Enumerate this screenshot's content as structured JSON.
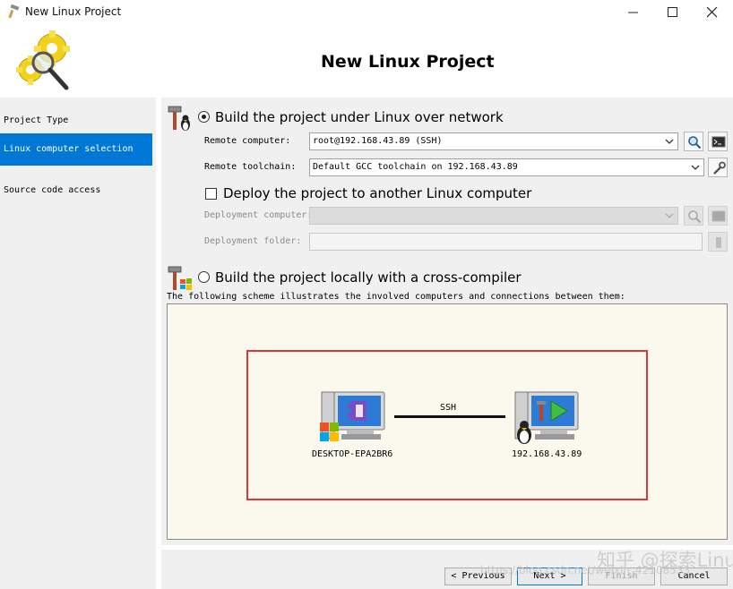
{
  "window": {
    "title": "New Linux Project"
  },
  "header": {
    "title": "New Linux Project"
  },
  "nav": {
    "items": [
      "Project Type",
      "Linux computer selection",
      "Source code access"
    ],
    "active_index": 1
  },
  "build_remote": {
    "label": "Build the project under Linux over network",
    "selected": true,
    "remote_computer_label": "Remote computer:",
    "remote_computer_value": "root@192.168.43.89 (SSH)",
    "remote_toolchain_label": "Remote toolchain:",
    "remote_toolchain_value": "Default GCC toolchain on 192.168.43.89"
  },
  "deploy": {
    "label": "Deploy the project to another Linux computer",
    "checked": false,
    "deployment_computer_label": "Deployment computer:",
    "deployment_folder_label": "Deployment folder:"
  },
  "build_local": {
    "label": "Build the project locally with a cross-compiler",
    "selected": false
  },
  "scheme": {
    "caption": "The following scheme illustrates the involved computers and connections between them:",
    "left_computer": "DESKTOP-EPA2BR6",
    "connection": "SSH",
    "right_computer": "192.168.43.89"
  },
  "footer": {
    "previous": "Previous",
    "next": "Next",
    "finish": "Finish",
    "cancel": "Cancel"
  },
  "watermark": {
    "main": "知乎 @探索Linux",
    "url": "https://blog.csdn.net/weixin_42108533"
  },
  "colors": {
    "accent": "#0078d7",
    "frame": "#d9373a",
    "scheme_bg": "#fbf8ee",
    "panel_bg": "#f0f0f0"
  },
  "icons": [
    "app-icon",
    "gear-magnifier-logo",
    "hammer-penguin-icon",
    "hammer-windows-icon",
    "search-icon",
    "terminal-icon",
    "wrench-icon",
    "folder-icon",
    "windows-pc-icon",
    "linux-pc-icon"
  ]
}
